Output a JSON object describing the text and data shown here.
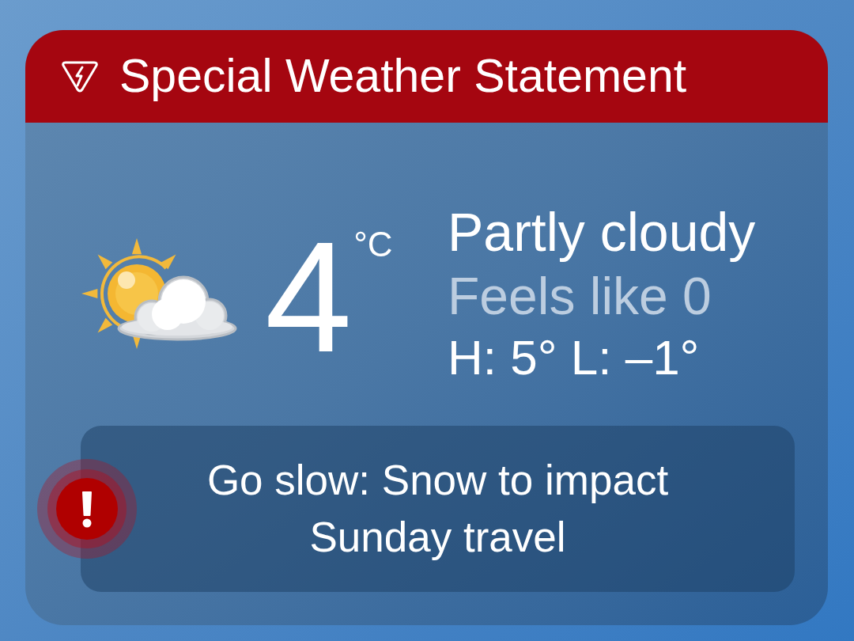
{
  "alert_banner": {
    "title": "Special Weather Statement"
  },
  "current": {
    "temperature": "4",
    "unit": "°C",
    "condition": "Partly cloudy",
    "feels_like": "Feels like 0",
    "high_low": "H: 5° L: –1°"
  },
  "headline": {
    "text": "Go slow: Snow to impact Sunday travel"
  }
}
